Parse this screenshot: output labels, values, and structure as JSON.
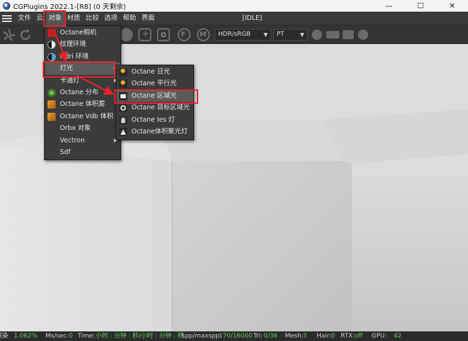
{
  "window": {
    "title": "CGPlugins    2022.1-[R8] (0 天剩余)",
    "minimize": "—",
    "maximize": "☐",
    "close": "✕"
  },
  "menubar": {
    "items": [
      "文件",
      "云",
      "对象",
      "材质",
      "比较",
      "选项",
      "帮助",
      "界面"
    ],
    "active_index": 2,
    "status": "[IDLE]"
  },
  "toolbar": {
    "color_space": "HDR/sRGB",
    "kernel": "PT"
  },
  "object_menu": {
    "items": [
      {
        "label": "Octane相机",
        "icon": "camera-icon",
        "submenu": false
      },
      {
        "label": "纹理环境",
        "icon": "texture-env-icon",
        "submenu": false
      },
      {
        "label": "Hdri 环境",
        "icon": "hdri-env-icon",
        "submenu": false
      },
      {
        "label": "灯光",
        "icon": "",
        "submenu": true
      },
      {
        "label": "卡通灯",
        "icon": "",
        "submenu": true
      },
      {
        "label": "Octane 分布",
        "icon": "scatter-icon",
        "submenu": false
      },
      {
        "label": "Octane 体积雾",
        "icon": "volume-fog-icon",
        "submenu": false
      },
      {
        "label": "Octane Vdb 体积",
        "icon": "vdb-volume-icon",
        "submenu": false
      },
      {
        "label": "Orbx 对象",
        "icon": "",
        "submenu": false
      },
      {
        "label": "Vectron",
        "icon": "",
        "submenu": true
      },
      {
        "label": "Sdf",
        "icon": "",
        "submenu": false
      }
    ],
    "highlighted_index": 3
  },
  "light_submenu": {
    "items": [
      {
        "label": "Octane 日光",
        "icon": "sun-icon"
      },
      {
        "label": "Octane 平行光",
        "icon": "sun-icon"
      },
      {
        "label": "Octane 区域光",
        "icon": "area-light-icon"
      },
      {
        "label": "Octane 目标区域光",
        "icon": "target-area-light-icon"
      },
      {
        "label": "Octane Ies 灯",
        "icon": "ies-light-icon"
      },
      {
        "label": "Octane体积聚光灯",
        "icon": "volume-spot-icon"
      }
    ],
    "highlighted_index": 2
  },
  "statusbar": {
    "loading_label": "渲染",
    "loading_value": "1.062%",
    "ms_label": "Ms/sec:",
    "ms_value": "0",
    "time_label": "Time:",
    "time_value": "小时 : 分钟 : 秒/小时 : 分钟 : 秒",
    "spp_label": "Spp/maxspp:",
    "spp_value": "170/16000",
    "tri_label": "Tri:",
    "tri_value": "0/36",
    "mesh_label": "Mesh:",
    "mesh_value": "3",
    "hair_label": "Hair:",
    "hair_value": "0",
    "rtx_label": "RTX:",
    "rtx_value": "off",
    "gpu_label": "GPU:",
    "gpu_value": "42"
  },
  "colors": {
    "highlight_box": "#e8242a",
    "status_value": "#5fcf5f",
    "menu_bg": "#3b3b3b"
  }
}
